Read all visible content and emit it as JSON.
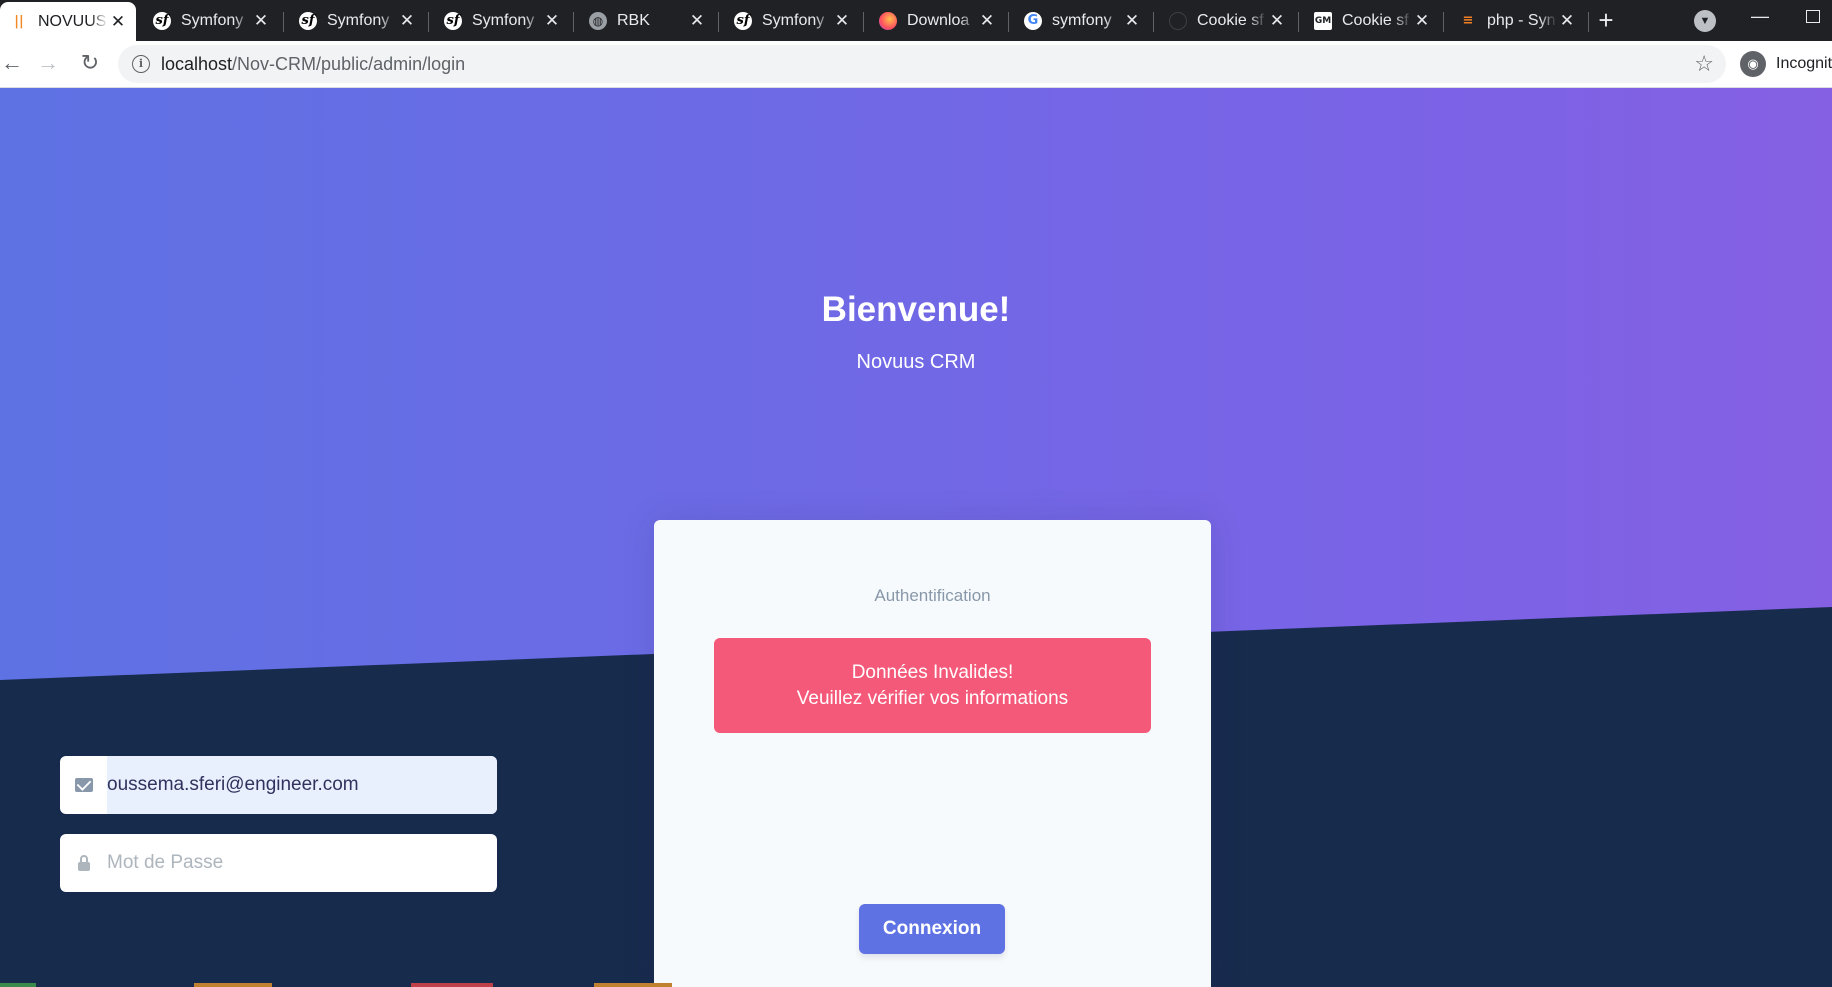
{
  "browser": {
    "tabs": [
      {
        "title": "NOVUUS",
        "icon": "novuus-logo-icon",
        "active": true
      },
      {
        "title": "Symfony",
        "icon": "symfony-icon"
      },
      {
        "title": "Symfony",
        "icon": "symfony-icon"
      },
      {
        "title": "Symfony",
        "icon": "symfony-icon"
      },
      {
        "title": "RBK",
        "icon": "globe-icon"
      },
      {
        "title": "Symfony",
        "icon": "symfony-icon"
      },
      {
        "title": "Downloa",
        "icon": "firefox-icon"
      },
      {
        "title": "symfony",
        "icon": "google-icon"
      },
      {
        "title": "Cookie sf",
        "icon": "github-icon"
      },
      {
        "title": "Cookie sf",
        "icon": "grafikart-icon"
      },
      {
        "title": "php - Syn",
        "icon": "stackoverflow-icon"
      }
    ],
    "url_host": "localhost",
    "url_path": "/Nov-CRM/public/admin/login",
    "profile_label": "Incognito"
  },
  "hero": {
    "title": "Bienvenue!",
    "subtitle": "Novuus CRM"
  },
  "login": {
    "heading": "Authentification",
    "alert_line1": "Données Invalides!",
    "alert_line2": "Veuillez vérifier vos informations",
    "email_value": "oussema.sferi@engineer.com",
    "password_placeholder": "Mot de Passe",
    "submit_label": "Connexion"
  },
  "colors": {
    "primary": "#5e72e4",
    "hero_end": "#8560e3",
    "dark_bg": "#172b4d",
    "alert": "#f5597a"
  }
}
